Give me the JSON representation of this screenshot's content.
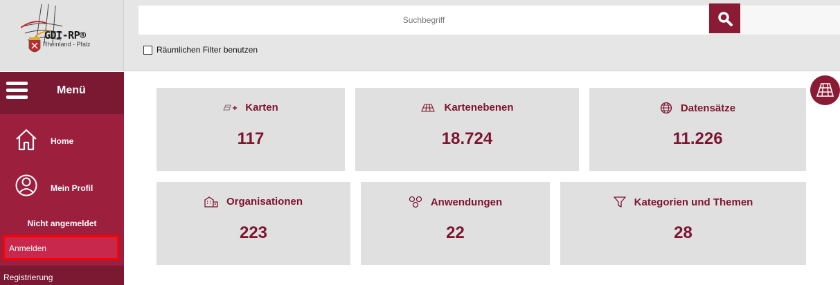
{
  "logo": {
    "title": "GDI-RP®",
    "subtitle": "Rheinland - Pfalz"
  },
  "search": {
    "placeholder": "Suchbegriff"
  },
  "filter": {
    "label": "Räumlichen Filter benutzen",
    "checked": false
  },
  "sidebar": {
    "menu_label": "Menü",
    "items": [
      {
        "label": "Home",
        "icon": "home-icon"
      },
      {
        "label": "Mein Profil",
        "icon": "user-icon"
      }
    ],
    "status": "Nicht angemeldet",
    "login": "Anmelden",
    "register": "Registrierung"
  },
  "tiles": [
    {
      "title": "Karten",
      "count": "117",
      "icon": "map-plus-icon"
    },
    {
      "title": "Kartenebenen",
      "count": "18.724",
      "icon": "grid-layer-icon"
    },
    {
      "title": "Datensätze",
      "count": "11.226",
      "icon": "globe-icon"
    },
    {
      "title": "Organisationen",
      "count": "223",
      "icon": "buildings-icon"
    },
    {
      "title": "Anwendungen",
      "count": "22",
      "icon": "apps-icon"
    },
    {
      "title": "Kategorien und Themen",
      "count": "28",
      "icon": "filter-icon"
    }
  ],
  "colors": {
    "primary": "#9c1f3e",
    "dark": "#7b1832",
    "accent_text": "#7d1430",
    "tile_bg": "#e0e0e0",
    "highlight_border": "#ff0000"
  }
}
